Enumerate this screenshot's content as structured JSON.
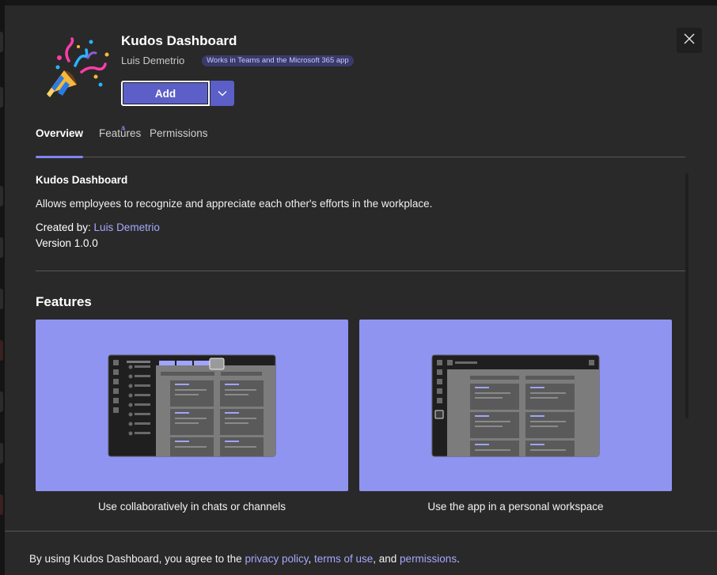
{
  "app": {
    "name": "Kudos Dashboard",
    "publisher": "Luis Demetrio",
    "badge": "Works in Teams and the Microsoft 365 app",
    "add_label": "Add"
  },
  "tabs": [
    {
      "label": "Overview",
      "active": true
    },
    {
      "label": "Features",
      "active": false
    },
    {
      "label": "Permissions",
      "active": false
    }
  ],
  "overview": {
    "title": "Kudos Dashboard",
    "description": "Allows employees to recognize and appreciate each other's efforts in the workplace.",
    "created_by_label": "Created by: ",
    "created_by_name": "Luis Demetrio",
    "version": "Version 1.0.0"
  },
  "features": {
    "title": "Features",
    "cards": [
      {
        "caption": "Use collaboratively in chats or channels"
      },
      {
        "caption": "Use the app in a personal workspace"
      }
    ]
  },
  "footer": {
    "prefix": "By using Kudos Dashboard, you agree to the ",
    "privacy": "privacy policy",
    "sep1": ", ",
    "terms": "terms of use",
    "sep2": ", and ",
    "permissions": "permissions",
    "suffix": "."
  },
  "colors": {
    "accent": "#5b5fc7",
    "link": "#a5a8ff",
    "card_bg": "#8f94f1",
    "dialog_bg": "#292929"
  },
  "icons": [
    "party-popper-icon",
    "chevron-down-icon",
    "close-icon"
  ]
}
